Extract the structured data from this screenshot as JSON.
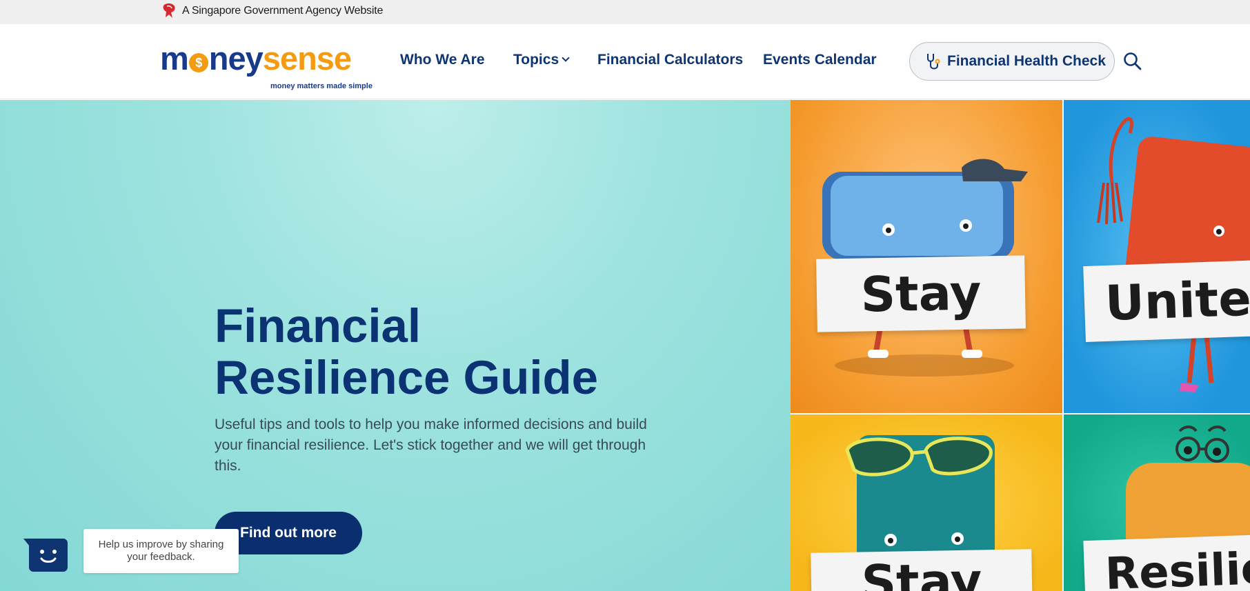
{
  "masthead": {
    "text": "A Singapore Government Agency Website"
  },
  "logo": {
    "word_part1": "m",
    "word_part2": "ney",
    "word_part3": "sense",
    "coin_symbol": "$",
    "tagline": "money matters made simple"
  },
  "nav": {
    "who_we_are": "Who We Are",
    "topics": "Topics",
    "financial_calculators": "Financial Calculators",
    "events_calendar": "Events Calendar"
  },
  "health_check_button": {
    "label": "Financial Health Check"
  },
  "hero": {
    "title_line1": "Financial",
    "title_line2": "Resilience Guide",
    "description": "Useful tips and tools to help you make informed decisions and build your financial resilience. Let's stick together and we will get through this.",
    "cta": "Find out more"
  },
  "tiles": [
    {
      "sign": "Stay",
      "color": "#f59b2e"
    },
    {
      "sign": "United",
      "color": "#1f95dc"
    },
    {
      "sign": "Stay",
      "color": "#f7b81c"
    },
    {
      "sign": "Resilient",
      "color": "#12a98a"
    }
  ],
  "feedback": {
    "text": "Help us improve by sharing your feedback."
  },
  "colors": {
    "brand_navy": "#0b2f6e",
    "brand_orange": "#f39c12",
    "hero_teal": "#9ee3df",
    "masthead_bg": "#f0f0f0"
  },
  "icons": {
    "masthead": "lion-head-icon",
    "health_check": "stethoscope-icon",
    "search": "search-icon",
    "feedback": "chatbot-face-icon",
    "topics": "chevron-down-icon"
  }
}
